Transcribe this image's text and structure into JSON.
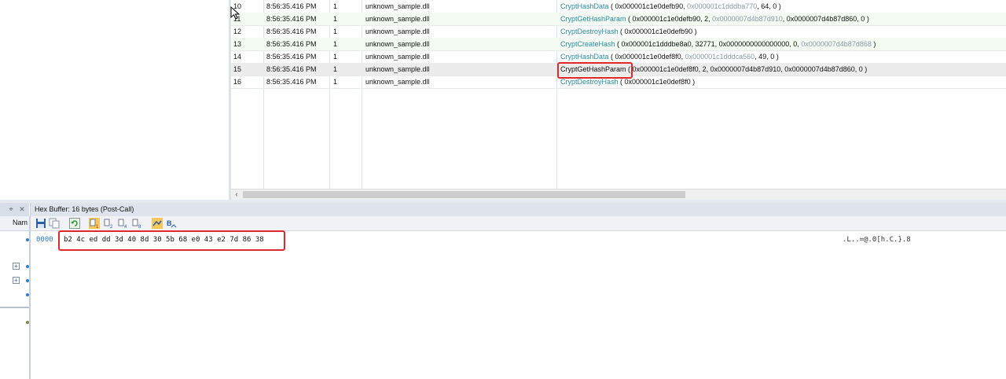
{
  "calls": {
    "rows": [
      {
        "num": "10",
        "time": "8:56:35.416 PM",
        "thread": "1",
        "module": "unknown_sample.dll",
        "api": "CryptHashData",
        "args": [
          {
            "t": " ( 0x000001c1e0defb90, ",
            "d": false
          },
          {
            "t": "0x000001c1dddba770",
            "d": true
          },
          {
            "t": ", 64, 0 )",
            "d": false
          }
        ]
      },
      {
        "num": "11",
        "time": "8:56:35.416 PM",
        "thread": "1",
        "module": "unknown_sample.dll",
        "api": "CryptGetHashParam",
        "args": [
          {
            "t": " ( 0x000001c1e0defb90, 2, ",
            "d": false
          },
          {
            "t": "0x0000007d4b87d910",
            "d": true
          },
          {
            "t": ", 0x0000007d4b87d860, 0 )",
            "d": false
          }
        ]
      },
      {
        "num": "12",
        "time": "8:56:35.416 PM",
        "thread": "1",
        "module": "unknown_sample.dll",
        "api": "CryptDestroyHash",
        "args": [
          {
            "t": " ( 0x000001c1e0defb90 )",
            "d": false
          }
        ]
      },
      {
        "num": "13",
        "time": "8:56:35.416 PM",
        "thread": "1",
        "module": "unknown_sample.dll",
        "api": "CryptCreateHash",
        "args": [
          {
            "t": " ( 0x000001c1dddbe8a0, 32771, 0x0000000000000000, 0, ",
            "d": false
          },
          {
            "t": "0x0000007d4b87d868",
            "d": true
          },
          {
            "t": " )",
            "d": false
          }
        ]
      },
      {
        "num": "14",
        "time": "8:56:35.416 PM",
        "thread": "1",
        "module": "unknown_sample.dll",
        "api": "CryptHashData",
        "args": [
          {
            "t": " ( 0x000001c1e0def8f0, ",
            "d": false
          },
          {
            "t": "0x000001c1dddca560",
            "d": true
          },
          {
            "t": ", 49, 0 )",
            "d": false
          }
        ]
      },
      {
        "num": "15",
        "time": "8:56:35.416 PM",
        "thread": "1",
        "module": "unknown_sample.dll",
        "api": "CryptGetHashParam",
        "args": [
          {
            "t": " ( 0x000001c1e0def8f0, 2, 0x0000007d4b87d910, 0x0000007d4b87d860, 0 )",
            "d": false
          }
        ]
      },
      {
        "num": "16",
        "time": "8:56:35.416 PM",
        "thread": "1",
        "module": "unknown_sample.dll",
        "api": "CryptDestroyHash",
        "args": [
          {
            "t": " ( 0x000001c1e0def8f0 )",
            "d": false
          }
        ]
      }
    ]
  },
  "hex_panel": {
    "title": "Hex Buffer: 16 bytes (Post-Call)",
    "offset": "0000",
    "bytes": "b2 4c ed dd 3d 40 8d 30 5b 68 e0 43 e2 7d 86 38",
    "ascii": ".L..=@.0[h.C.}.8"
  },
  "side_list": {
    "header": "Nam"
  },
  "colors": {
    "api_link": "#2a8da0",
    "highlight": "#e0282e",
    "offset": "#2e7bd6"
  }
}
